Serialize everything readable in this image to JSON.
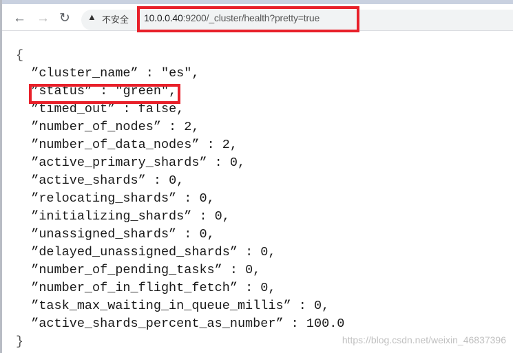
{
  "browser": {
    "security_label": "不安全",
    "url_host": "10.0.0.40",
    "url_rest": ":9200/_cluster/health?pretty=true",
    "highlight_color": "#e8202a"
  },
  "json_lines": [
    {
      "key": "cluster_name",
      "value": "\"es\","
    },
    {
      "key": "status",
      "value": "\"green\","
    },
    {
      "key": "timed_out",
      "value": "false,"
    },
    {
      "key": "number_of_nodes",
      "value": "2,"
    },
    {
      "key": "number_of_data_nodes",
      "value": "2,"
    },
    {
      "key": "active_primary_shards",
      "value": "0,"
    },
    {
      "key": "active_shards",
      "value": "0,"
    },
    {
      "key": "relocating_shards",
      "value": "0,"
    },
    {
      "key": "initializing_shards",
      "value": "0,"
    },
    {
      "key": "unassigned_shards",
      "value": "0,"
    },
    {
      "key": "delayed_unassigned_shards",
      "value": "0,"
    },
    {
      "key": "number_of_pending_tasks",
      "value": "0,"
    },
    {
      "key": "number_of_in_flight_fetch",
      "value": "0,"
    },
    {
      "key": "task_max_waiting_in_queue_millis",
      "value": "0,"
    },
    {
      "key": "active_shards_percent_as_number",
      "value": "100.0"
    }
  ],
  "open_brace": "{",
  "close_brace": "}",
  "watermark": "https://blog.csdn.net/weixin_46837396"
}
